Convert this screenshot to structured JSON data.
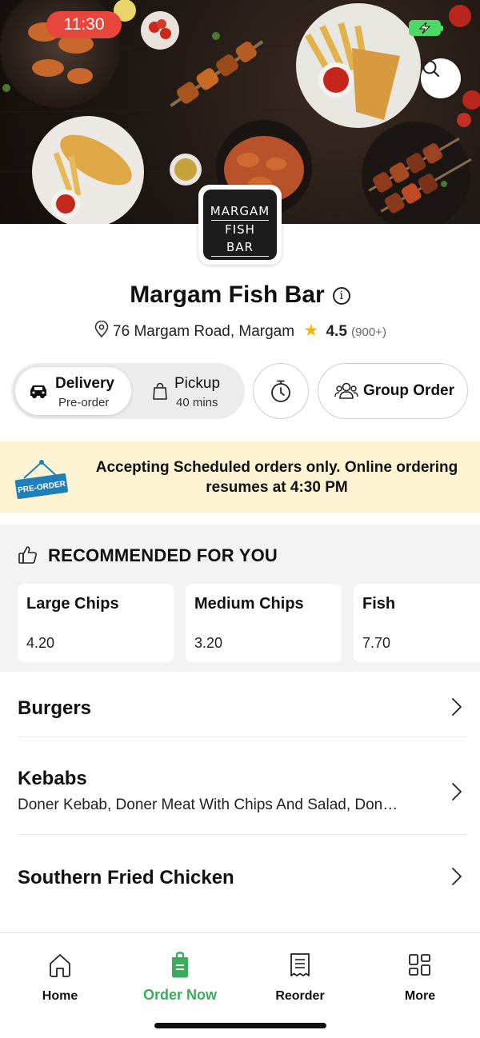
{
  "status_bar": {
    "time": "11:30"
  },
  "store": {
    "logo_text": [
      "MARGAM",
      "FISH BAR"
    ],
    "name": "Margam Fish Bar",
    "address": "76 Margam Road, Margam",
    "rating": "4.5",
    "rating_count": "(900+)"
  },
  "order_mode": {
    "delivery": {
      "label": "Delivery",
      "sub": "Pre-order",
      "selected": true
    },
    "pickup": {
      "label": "Pickup",
      "sub": "40 mins",
      "selected": false
    },
    "group_order_label": "Group Order"
  },
  "banner": {
    "tag_text": "PRE-ORDER",
    "message": "Accepting Scheduled orders only. Online ordering resumes at 4:30 PM"
  },
  "recommended": {
    "heading": "RECOMMENDED FOR YOU",
    "items": [
      {
        "name": "Large Chips",
        "price": "4.20"
      },
      {
        "name": "Medium Chips",
        "price": "3.20"
      },
      {
        "name": "Fish",
        "price": "7.70"
      }
    ]
  },
  "categories": [
    {
      "name": "Burgers",
      "desc": ""
    },
    {
      "name": "Kebabs",
      "desc": "Doner Kebab, Doner Meat With Chips And Salad, Don…"
    },
    {
      "name": "Southern Fried Chicken",
      "desc": ""
    }
  ],
  "bottom_nav": [
    {
      "label": "Home",
      "icon": "home-icon",
      "active": false
    },
    {
      "label": "Order Now",
      "icon": "order-bag-icon",
      "active": true
    },
    {
      "label": "Reorder",
      "icon": "receipt-icon",
      "active": false
    },
    {
      "label": "More",
      "icon": "grid-icon",
      "active": false
    }
  ],
  "colors": {
    "accent_green": "#3dac5a",
    "banner_bg": "#fcf3d2",
    "time_pill": "#e8453c",
    "star": "#f5b400",
    "tag_blue": "#1f7fb8"
  }
}
